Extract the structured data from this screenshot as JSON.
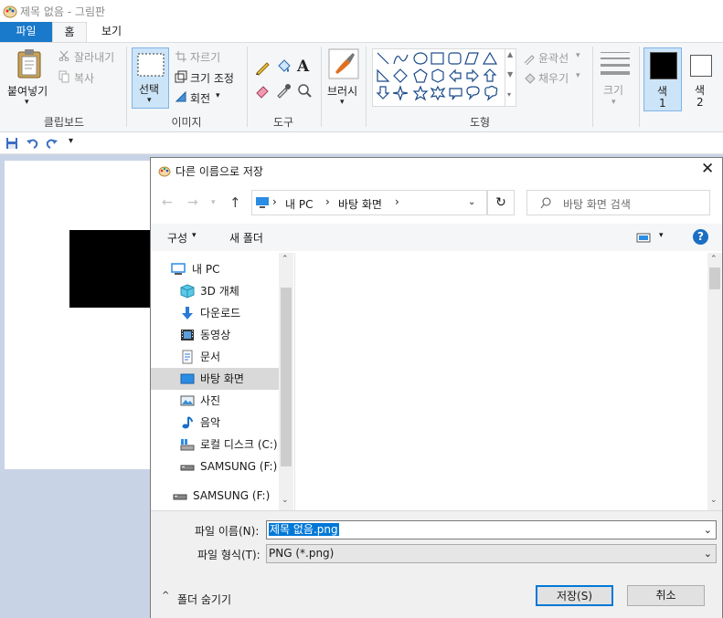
{
  "window": {
    "title": "제목 없음 - 그림판"
  },
  "tabs": [
    "파일",
    "홈",
    "보기"
  ],
  "ribbon": {
    "clipboard": {
      "paste": "붙여넣기",
      "cut": "잘라내기",
      "copy": "복사",
      "label": "클립보드"
    },
    "image": {
      "select": "선택",
      "crop": "자르기",
      "resize": "크기 조정",
      "rotate": "회전",
      "label": "이미지"
    },
    "tools": {
      "label": "도구",
      "text_glyph": "A"
    },
    "brush": {
      "label": "브러시"
    },
    "shapes": {
      "outline": "윤곽선",
      "fill": "채우기",
      "label": "도형"
    },
    "size": {
      "label": "크기"
    },
    "color1": {
      "label": "색",
      "num": "1",
      "value": "#000000"
    },
    "color2": {
      "label": "색",
      "num": "2",
      "value": "#ffffff"
    }
  },
  "dialog": {
    "title": "다른 이름으로 저장",
    "breadcrumb": [
      "내 PC",
      "바탕 화면"
    ],
    "search_placeholder": "바탕 화면 검색",
    "organize": "구성",
    "new_folder": "새 폴더",
    "nav_items": [
      {
        "label": "내 PC",
        "icon": "pc-icon"
      },
      {
        "label": "3D 개체",
        "icon": "3d-objects-icon"
      },
      {
        "label": "다운로드",
        "icon": "download-icon"
      },
      {
        "label": "동영상",
        "icon": "video-icon"
      },
      {
        "label": "문서",
        "icon": "document-icon"
      },
      {
        "label": "바탕 화면",
        "icon": "desktop-icon",
        "selected": true
      },
      {
        "label": "사진",
        "icon": "pictures-icon"
      },
      {
        "label": "음악",
        "icon": "music-icon"
      },
      {
        "label": "로컬 디스크 (C:)",
        "icon": "disk-icon"
      },
      {
        "label": "SAMSUNG (F:)",
        "icon": "usb-drive-icon"
      },
      {
        "label": "SAMSUNG (F:)",
        "icon": "usb-drive-icon"
      }
    ],
    "filename_label": "파일 이름(N):",
    "filename_value": "제목 없음.png",
    "filetype_label": "파일 형식(T):",
    "filetype_value": "PNG (*.png)",
    "hide_folders": "폴더 숨기기",
    "save": "저장(S)",
    "cancel": "취소"
  },
  "colors": {
    "accent": "#1979ca",
    "selection": "#cce4f7"
  }
}
